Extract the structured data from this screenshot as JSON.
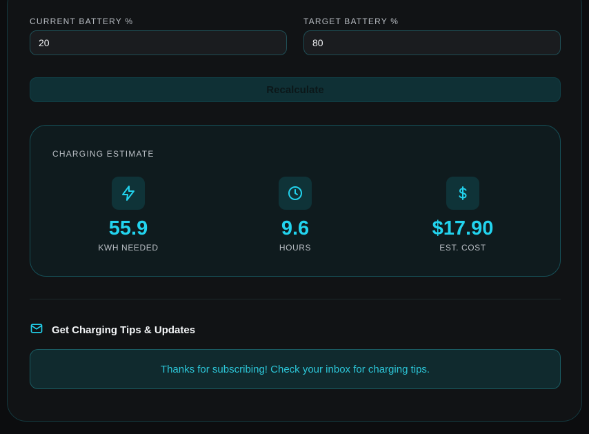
{
  "inputs": {
    "current": {
      "label": "CURRENT BATTERY %",
      "value": "20"
    },
    "target": {
      "label": "TARGET BATTERY %",
      "value": "80"
    }
  },
  "actions": {
    "recalculate_label": "Recalculate"
  },
  "estimate": {
    "title": "CHARGING ESTIMATE",
    "metrics": [
      {
        "icon": "lightning-icon",
        "value": "55.9",
        "label": "KWH NEEDED"
      },
      {
        "icon": "clock-icon",
        "value": "9.6",
        "label": "HOURS"
      },
      {
        "icon": "dollar-icon",
        "value": "$17.90",
        "label": "EST. COST"
      }
    ]
  },
  "newsletter": {
    "icon": "mail-icon",
    "title": "Get Charging Tips & Updates",
    "success_message": "Thanks for subscribing! Check your inbox for charging tips."
  },
  "colors": {
    "accent": "#22d3ee",
    "background": "#0c0d0f",
    "card": "#111315",
    "border": "#165058"
  }
}
